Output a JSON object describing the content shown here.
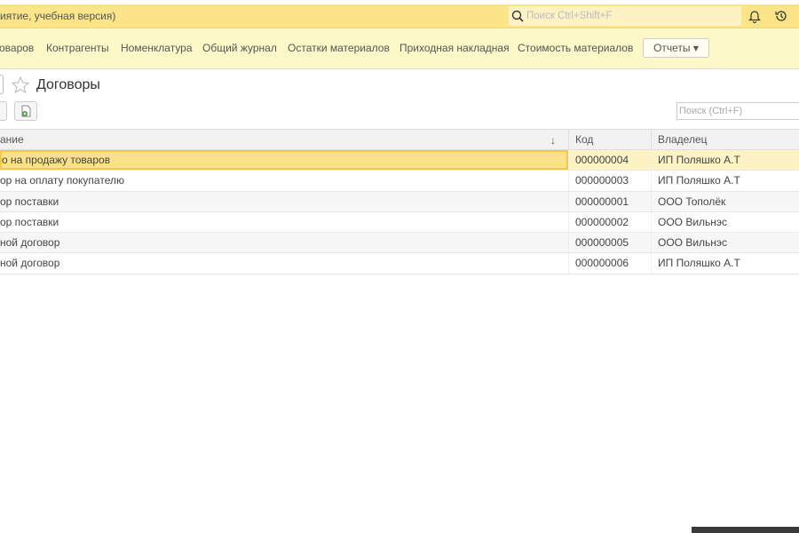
{
  "window": {
    "title": "иятие, учебная версия)",
    "search_placeholder": "Поиск Ctrl+Shift+F"
  },
  "nav": {
    "items": [
      "оваров",
      "Контрагенты",
      "Номенклатура",
      "Общий журнал",
      "Остатки материалов",
      "Приходная накладная",
      "Стоимость материалов"
    ],
    "reports": "Отчеты ▾"
  },
  "page": {
    "title": "Договоры",
    "search_placeholder": "Поиск (Ctrl+F)"
  },
  "table": {
    "columns": [
      "ание",
      "Код",
      "Владелец"
    ],
    "sort_indicator": "↓",
    "rows": [
      {
        "name": "о на продажу товаров",
        "code": "000000004",
        "owner": "ИП Поляшко А.Т"
      },
      {
        "name": "ор на оплату покупателю",
        "code": "000000003",
        "owner": "ИП Поляшко А.Т"
      },
      {
        "name": "ор поставки",
        "code": "000000001",
        "owner": "ООО Тополёк"
      },
      {
        "name": "ор поставки",
        "code": "000000002",
        "owner": "ООО Вильнэс"
      },
      {
        "name": "ной договор",
        "code": "000000005",
        "owner": "ООО Вильнэс"
      },
      {
        "name": "ной договор",
        "code": "000000006",
        "owner": "ИП Поляшко А.Т"
      }
    ]
  }
}
